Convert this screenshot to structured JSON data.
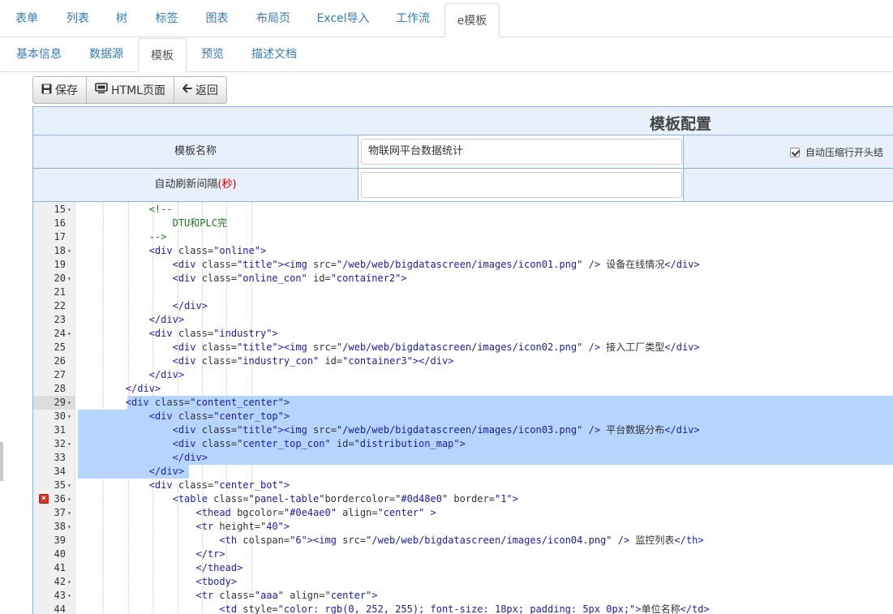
{
  "tabs_primary": [
    {
      "label": "表单",
      "active": false
    },
    {
      "label": "列表",
      "active": false
    },
    {
      "label": "树",
      "active": false
    },
    {
      "label": "标签",
      "active": false
    },
    {
      "label": "图表",
      "active": false
    },
    {
      "label": "布局页",
      "active": false
    },
    {
      "label": "Excel导入",
      "active": false
    },
    {
      "label": "工作流",
      "active": false
    },
    {
      "label": "e模板",
      "active": true
    }
  ],
  "tabs_secondary": [
    {
      "label": "基本信息",
      "active": false
    },
    {
      "label": "数据源",
      "active": false
    },
    {
      "label": "模板",
      "active": true
    },
    {
      "label": "预览",
      "active": false
    },
    {
      "label": "描述文档",
      "active": false
    }
  ],
  "toolbar": {
    "save_label": "保存",
    "html_label": "HTML页面",
    "back_label": "返回"
  },
  "config": {
    "title": "模板配置",
    "name_label": "模板名称",
    "name_value": "物联网平台数据统计",
    "compress_label": "自动压缩行开头结",
    "compress_checked": true,
    "refresh_label": "自动刷新间隔",
    "refresh_unit": "(秒)",
    "refresh_value": ""
  },
  "editor": {
    "active_line": 29,
    "error_line": 36,
    "lines": [
      {
        "n": 15,
        "fold": true,
        "text": "            <!--"
      },
      {
        "n": 16,
        "fold": false,
        "text": "                DTU和PLC完"
      },
      {
        "n": 17,
        "fold": false,
        "text": "            -->"
      },
      {
        "n": 18,
        "fold": true,
        "text": "            <div class=\"online\">"
      },
      {
        "n": 19,
        "fold": false,
        "text": "                <div class=\"title\"><img src=\"/web/web/bigdatascreen/images/icon01.png\" /> 设备在线情况</div>"
      },
      {
        "n": 20,
        "fold": true,
        "text": "                <div class=\"online_con\" id=\"container2\">"
      },
      {
        "n": 21,
        "fold": false,
        "text": ""
      },
      {
        "n": 22,
        "fold": false,
        "text": "                </div>"
      },
      {
        "n": 23,
        "fold": false,
        "text": "            </div>"
      },
      {
        "n": 24,
        "fold": true,
        "text": "            <div class=\"industry\">"
      },
      {
        "n": 25,
        "fold": false,
        "text": "                <div class=\"title\"><img src=\"/web/web/bigdatascreen/images/icon02.png\" /> 接入工厂类型</div>"
      },
      {
        "n": 26,
        "fold": false,
        "text": "                <div class=\"industry_con\" id=\"container3\"></div>"
      },
      {
        "n": 27,
        "fold": false,
        "text": "            </div>"
      },
      {
        "n": 28,
        "fold": false,
        "text": "        </div>"
      },
      {
        "n": 29,
        "fold": true,
        "text": "        <div class=\"content_center\">"
      },
      {
        "n": 30,
        "fold": true,
        "text": "            <div class=\"center_top\">"
      },
      {
        "n": 31,
        "fold": false,
        "text": "                <div class=\"title\"><img src=\"/web/web/bigdatascreen/images/icon03.png\" /> 平台数据分布</div>"
      },
      {
        "n": 32,
        "fold": true,
        "text": "                <div class=\"center_top_con\" id=\"distribution_map\">"
      },
      {
        "n": 33,
        "fold": false,
        "text": "                </div>"
      },
      {
        "n": 34,
        "fold": false,
        "text": "            </div>"
      },
      {
        "n": 35,
        "fold": true,
        "text": "            <div class=\"center_bot\">"
      },
      {
        "n": 36,
        "fold": true,
        "text": "                <table class=\"panel-table\"bordercolor=\"#0d48e0\" border=\"1\">"
      },
      {
        "n": 37,
        "fold": true,
        "text": "                    <thead bgcolor=\"#0e4ae0\" align=\"center\" >"
      },
      {
        "n": 38,
        "fold": true,
        "text": "                    <tr height=\"40\">"
      },
      {
        "n": 39,
        "fold": false,
        "text": "                        <th colspan=\"6\"><img src=\"/web/web/bigdatascreen/images/icon04.png\" /> 监控列表</th>"
      },
      {
        "n": 40,
        "fold": false,
        "text": "                    </tr>"
      },
      {
        "n": 41,
        "fold": false,
        "text": "                    </thead>"
      },
      {
        "n": 42,
        "fold": true,
        "text": "                    <tbody>"
      },
      {
        "n": 43,
        "fold": true,
        "text": "                    <tr class=\"aaa\" align=\"center\">"
      },
      {
        "n": 44,
        "fold": false,
        "text": "                        <td style=\"color: rgb(0, 252, 255); font-size: 18px; padding: 5px 0px;\">单位名称</td>"
      }
    ]
  },
  "colors": {
    "link": "#337ab7",
    "table_border": "#8db2dd",
    "table_bg": "#e8f1fb",
    "selection": "#b5d5ff",
    "error": "#d9342b"
  },
  "icons": [
    "save-icon",
    "monitor-icon",
    "arrow-left-icon",
    "fold-arrow-icon",
    "error-icon",
    "checkbox-icon"
  ]
}
